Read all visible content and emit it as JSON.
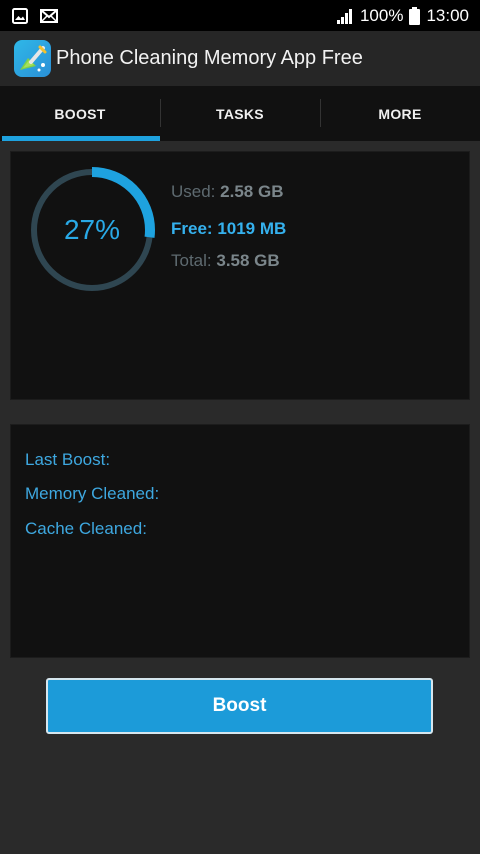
{
  "status_bar": {
    "battery_text": "100%",
    "time": "13:00",
    "left_icons": [
      "image-notification-icon",
      "mail-notification-icon"
    ],
    "right_icons": [
      "signal-icon",
      "battery-icon"
    ]
  },
  "app": {
    "title": "Phone Cleaning Memory App Free",
    "icon": "broom-app-icon"
  },
  "tabs": [
    {
      "label": "BOOST",
      "active": true
    },
    {
      "label": "TASKS",
      "active": false
    },
    {
      "label": "MORE",
      "active": false
    }
  ],
  "memory": {
    "percent_text": "27%",
    "percent_value": 27,
    "used_label": "Used:",
    "used_value": "2.58 GB",
    "free_label": "Free:",
    "free_value": "1019 MB",
    "total_label": "Total:",
    "total_value": "3.58 GB"
  },
  "stats": {
    "last_boost_label": "Last Boost:",
    "memory_cleaned_label": "Memory Cleaned:",
    "cache_cleaned_label": "Cache Cleaned:"
  },
  "actions": {
    "boost_label": "Boost"
  },
  "colors": {
    "accent": "#1ea2df",
    "ring_track": "#2f4651",
    "ring_fill": "#1ea2df",
    "button": "#1c9bd9",
    "background": "#2a2a2a",
    "card": "#111111"
  }
}
